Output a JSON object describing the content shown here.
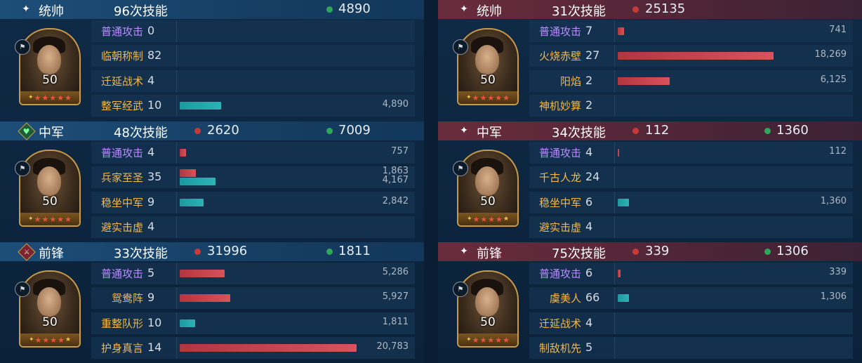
{
  "bar_scale_max": 20783,
  "colors": {
    "damage": "#c83a3a",
    "heal": "#2fa65a",
    "basic_attack": "#b98bff",
    "skill": "#f2b84b"
  },
  "teams": [
    {
      "side": "left",
      "generals": [
        {
          "role": "统帅",
          "role_icon": "sparkle-icon",
          "casts": "96次技能",
          "damage": null,
          "heal": "4890",
          "level": "50",
          "red_stars": 5,
          "skills": [
            {
              "name": "普通攻击",
              "type": "basic",
              "count": "0",
              "damage": null,
              "heal": null
            },
            {
              "name": "临朝称制",
              "type": "skill",
              "count": "82",
              "damage": null,
              "heal": null
            },
            {
              "name": "迁延战术",
              "type": "skill",
              "count": "4",
              "damage": null,
              "heal": null
            },
            {
              "name": "整军经武",
              "type": "skill",
              "count": "10",
              "damage": null,
              "heal": "4,890"
            }
          ]
        },
        {
          "role": "中军",
          "role_icon": "shield-heart-icon",
          "casts": "48次技能",
          "damage": "2620",
          "heal": "7009",
          "level": "50",
          "red_stars": 5,
          "skills": [
            {
              "name": "普通攻击",
              "type": "basic",
              "count": "4",
              "damage": "757",
              "heal": null
            },
            {
              "name": "兵家至圣",
              "type": "skill",
              "count": "35",
              "damage": "1,863",
              "heal": "4,167"
            },
            {
              "name": "稳坐中军",
              "type": "skill",
              "count": "9",
              "damage": null,
              "heal": "2,842"
            },
            {
              "name": "避实击虚",
              "type": "skill",
              "count": "4",
              "damage": null,
              "heal": null
            }
          ]
        },
        {
          "role": "前锋",
          "role_icon": "sword-icon",
          "casts": "33次技能",
          "damage": "31996",
          "heal": "1811",
          "level": "50",
          "red_stars": 4,
          "skills": [
            {
              "name": "普通攻击",
              "type": "basic",
              "count": "5",
              "damage": "5,286",
              "heal": null
            },
            {
              "name": "鸳鸯阵",
              "type": "skill",
              "count": "9",
              "damage": "5,927",
              "heal": null
            },
            {
              "name": "重整队形",
              "type": "skill",
              "count": "10",
              "damage": null,
              "heal": "1,811"
            },
            {
              "name": "护身真言",
              "type": "skill",
              "count": "14",
              "damage": "20,783",
              "heal": null
            }
          ]
        }
      ]
    },
    {
      "side": "right",
      "generals": [
        {
          "role": "统帅",
          "role_icon": "sparkle-icon",
          "casts": "31次技能",
          "damage": "25135",
          "heal": null,
          "level": "50",
          "red_stars": 5,
          "skills": [
            {
              "name": "普通攻击",
              "type": "basic",
              "count": "7",
              "damage": "741",
              "heal": null
            },
            {
              "name": "火烧赤壁",
              "type": "skill",
              "count": "27",
              "damage": "18,269",
              "heal": null
            },
            {
              "name": "阳焰",
              "type": "skill",
              "count": "2",
              "damage": "6,125",
              "heal": null
            },
            {
              "name": "神机妙算",
              "type": "skill",
              "count": "2",
              "damage": null,
              "heal": null
            }
          ]
        },
        {
          "role": "中军",
          "role_icon": "sparkle-icon",
          "casts": "34次技能",
          "damage": "112",
          "heal": "1360",
          "level": "50",
          "red_stars": 4,
          "skills": [
            {
              "name": "普通攻击",
              "type": "basic",
              "count": "4",
              "damage": "112",
              "heal": null
            },
            {
              "name": "千古人龙",
              "type": "skill",
              "count": "24",
              "damage": null,
              "heal": null
            },
            {
              "name": "稳坐中军",
              "type": "skill",
              "count": "6",
              "damage": null,
              "heal": "1,360"
            },
            {
              "name": "避实击虚",
              "type": "skill",
              "count": "4",
              "damage": null,
              "heal": null
            }
          ]
        },
        {
          "role": "前锋",
          "role_icon": "sparkle-icon",
          "casts": "75次技能",
          "damage": "339",
          "heal": "1306",
          "level": "50",
          "red_stars": 5,
          "skills": [
            {
              "name": "普通攻击",
              "type": "basic",
              "count": "6",
              "damage": "339",
              "heal": null
            },
            {
              "name": "虞美人",
              "type": "skill",
              "count": "66",
              "damage": null,
              "heal": "1,306"
            },
            {
              "name": "迁延战术",
              "type": "skill",
              "count": "4",
              "damage": null,
              "heal": null
            },
            {
              "name": "制敌机先",
              "type": "skill",
              "count": "5",
              "damage": null,
              "heal": null
            }
          ]
        }
      ]
    }
  ]
}
